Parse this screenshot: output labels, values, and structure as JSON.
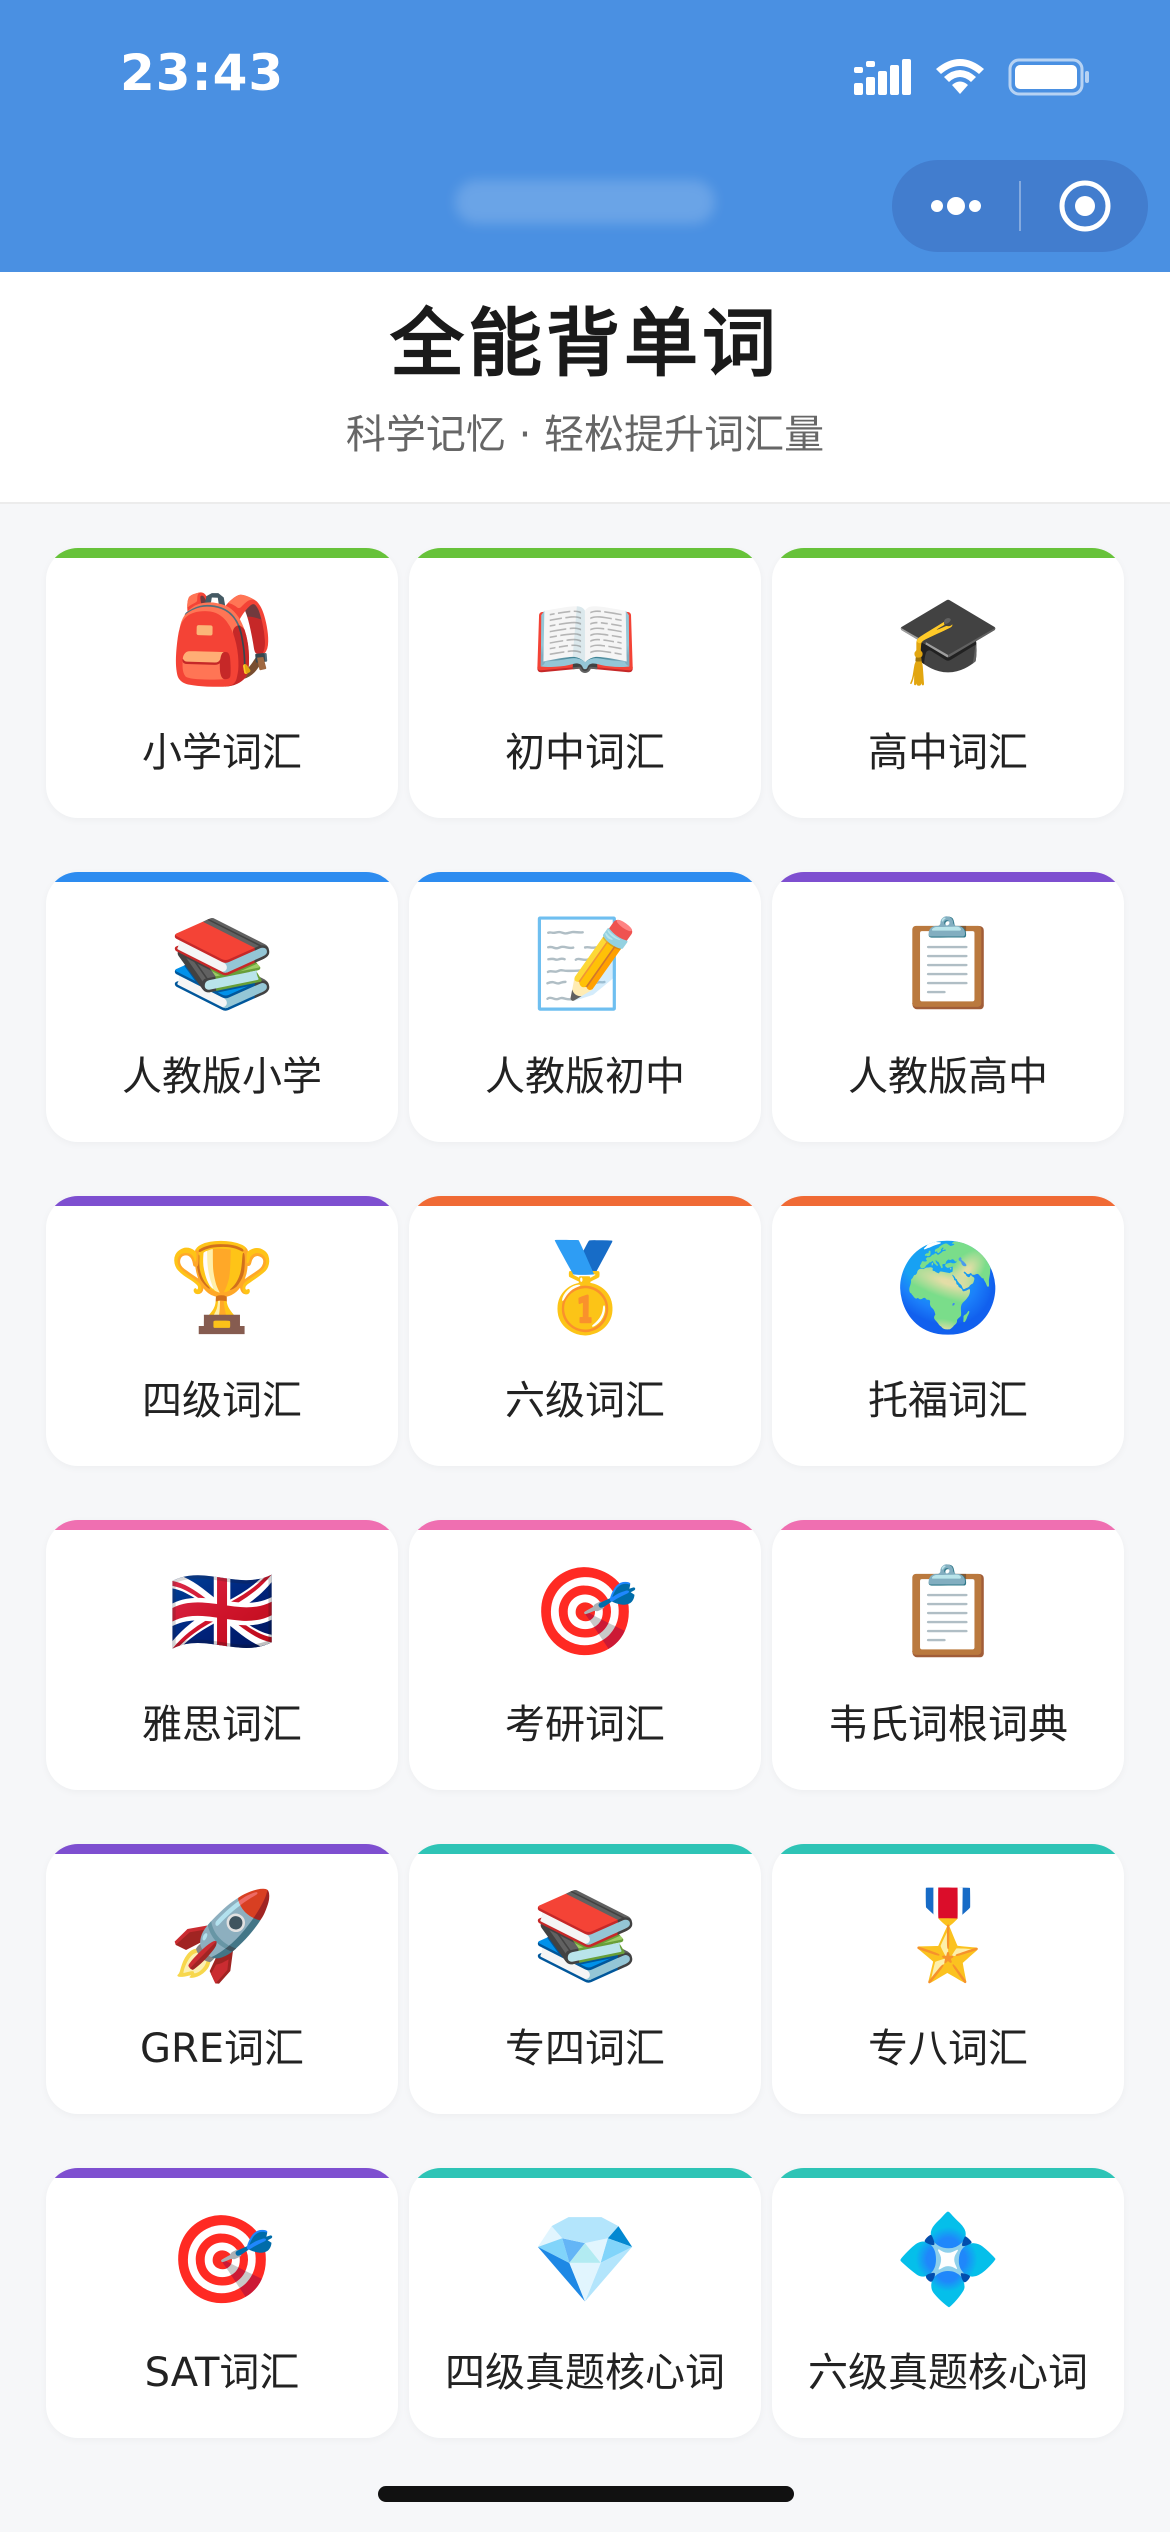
{
  "status_bar": {
    "time": "23:43"
  },
  "header": {
    "title": "全能背单词",
    "subtitle": "科学记忆 · 轻松提升词汇量"
  },
  "colors": {
    "nav_bg": "#4a90e2",
    "green": "#67c23a",
    "blue": "#2d8cf0",
    "purple": "#7e4fd0",
    "orange": "#f06a35",
    "pink": "#ef6fb1",
    "teal": "#2ec4b6"
  },
  "categories": [
    {
      "label": "小学词汇",
      "emoji": "🎒",
      "icon": "backpack-icon",
      "color": "#67c23a"
    },
    {
      "label": "初中词汇",
      "emoji": "📖",
      "icon": "open-book-icon",
      "color": "#67c23a"
    },
    {
      "label": "高中词汇",
      "emoji": "🎓",
      "icon": "graduation-cap-icon",
      "color": "#67c23a"
    },
    {
      "label": "人教版小学",
      "emoji": "📚",
      "icon": "books-icon",
      "color": "#2d8cf0"
    },
    {
      "label": "人教版初中",
      "emoji": "📝",
      "icon": "memo-icon",
      "color": "#2d8cf0"
    },
    {
      "label": "人教版高中",
      "emoji": "📋",
      "icon": "clipboard-icon",
      "color": "#7e4fd0"
    },
    {
      "label": "四级词汇",
      "emoji": "🏆",
      "icon": "trophy-icon",
      "color": "#7e4fd0"
    },
    {
      "label": "六级词汇",
      "emoji": "🥇",
      "icon": "gold-medal-icon",
      "color": "#f06a35"
    },
    {
      "label": "托福词汇",
      "emoji": "🌍",
      "icon": "globe-icon",
      "color": "#f06a35"
    },
    {
      "label": "雅思词汇",
      "emoji": "🇬🇧",
      "icon": "uk-flag-icon",
      "color": "#ef6fb1"
    },
    {
      "label": "考研词汇",
      "emoji": "🎯",
      "icon": "target-icon",
      "color": "#ef6fb1"
    },
    {
      "label": "韦氏词根词典",
      "emoji": "📋",
      "icon": "clipboard-icon",
      "color": "#ef6fb1"
    },
    {
      "label": "GRE词汇",
      "emoji": "🚀",
      "icon": "rocket-icon",
      "color": "#7e4fd0"
    },
    {
      "label": "专四词汇",
      "emoji": "📚",
      "icon": "books-icon",
      "color": "#2ec4b6"
    },
    {
      "label": "专八词汇",
      "emoji": "🎖️",
      "icon": "military-medal-icon",
      "color": "#2ec4b6"
    },
    {
      "label": "SAT词汇",
      "emoji": "🎯",
      "icon": "target-icon",
      "color": "#7e4fd0"
    },
    {
      "label": "四级真题核心词",
      "emoji": "💎",
      "icon": "gem-icon",
      "color": "#2ec4b6"
    },
    {
      "label": "六级真题核心词",
      "emoji": "💠",
      "icon": "diamond-shape-icon",
      "color": "#2ec4b6"
    }
  ]
}
